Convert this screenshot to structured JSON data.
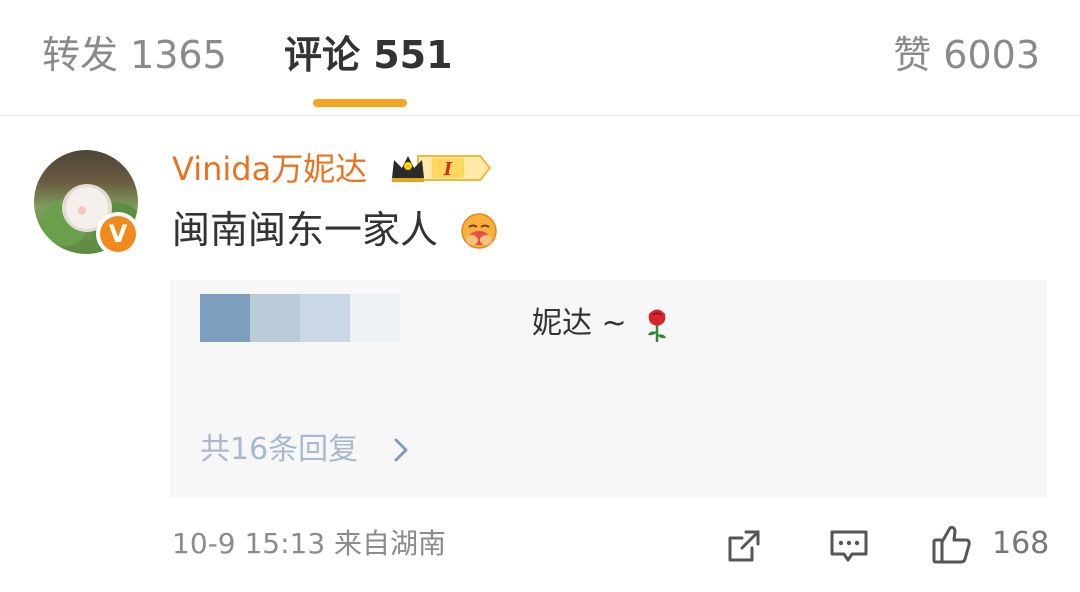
{
  "tabs": {
    "repost": "转发 1365",
    "comments": "评论 551",
    "likes": "赞 6003"
  },
  "comment": {
    "username": "Vinida万妮达",
    "text": "闽南闽东一家人",
    "emoji": "hug-emoji",
    "badge": "V",
    "level_badge": "I"
  },
  "reply_preview": {
    "snippet": "妮达 ~",
    "more_label": "共16条回复",
    "icon": "rose-icon"
  },
  "footer": {
    "time_location": "10-9 15:13 来自湖南",
    "like_count": "168"
  },
  "colors": {
    "accent": "#f5a623",
    "username": "#eb7320",
    "link": "#a9b9cd"
  }
}
